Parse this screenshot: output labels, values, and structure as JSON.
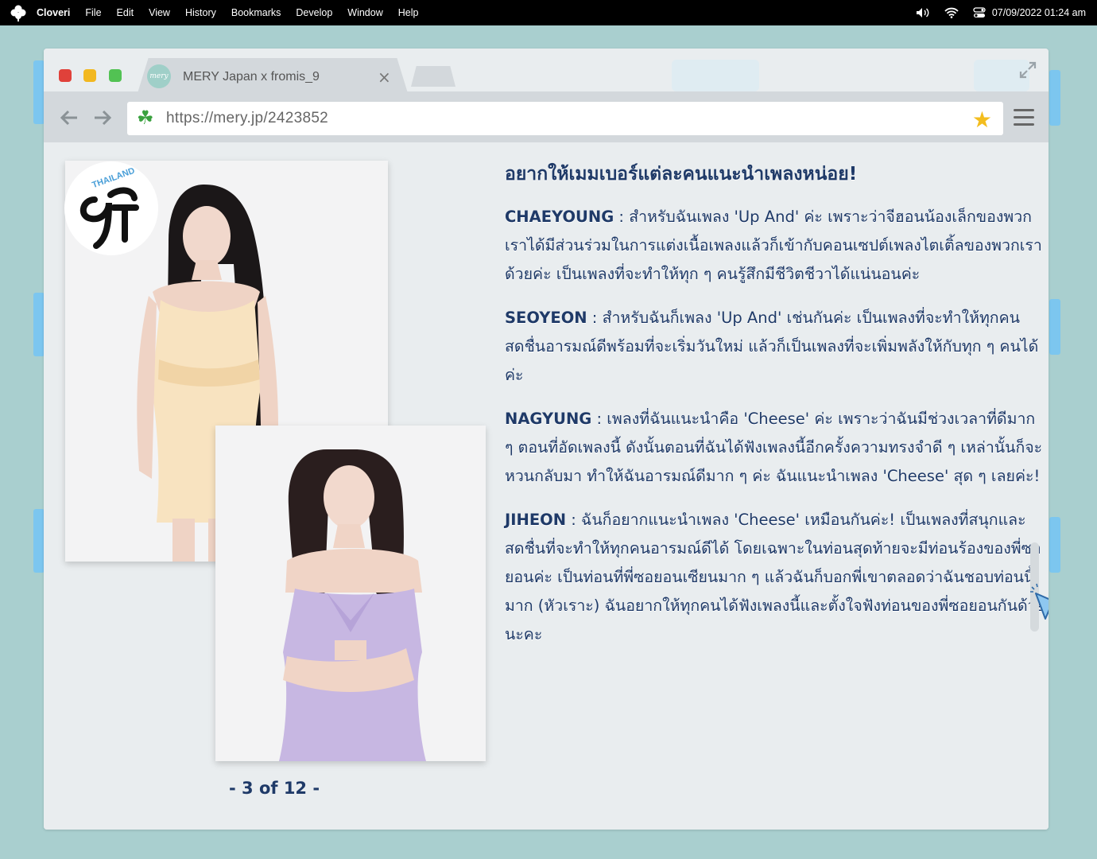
{
  "menubar": {
    "app_name": "Cloveri",
    "items": [
      "File",
      "Edit",
      "View",
      "History",
      "Bookmarks",
      "Develop",
      "Window",
      "Help"
    ],
    "datetime": "07/09/2022  01:24 am",
    "icons": [
      "clover-logo-icon",
      "volume-icon",
      "wifi-icon",
      "toggle-icon"
    ]
  },
  "browser": {
    "tab": {
      "favicon_text": "mery",
      "title": "MERY Japan x fromis_9",
      "close": "×"
    },
    "url": "https://mery.jp/2423852",
    "colors": {
      "red": "#e0413a",
      "yellow": "#f2b820",
      "green": "#52c253",
      "accent": "#1f3a68"
    }
  },
  "article": {
    "heading": "อยากให้เมมเบอร์แต่ละคนแนะนำเพลงหน่อย!",
    "paragraphs": [
      {
        "name": "CHAEYOUNG",
        "sep": " : ",
        "text": "สำหรับฉันเพลง 'Up And' ค่ะ เพราะว่าจีฮอนน้องเล็กของพวกเราได้มีส่วนร่วมในการแต่งเนื้อเพลงแล้วก็เข้ากับคอนเซปต์เพลงไตเติ้ลของพวกเราด้วยค่ะ เป็นเพลงที่จะทำให้ทุก ๆ คนรู้สึกมีชีวิตชีวาได้แน่นอนค่ะ"
      },
      {
        "name": "SEOYEON",
        "sep": " : ",
        "text": "สำหรับฉันก็เพลง 'Up And' เช่นกันค่ะ เป็นเพลงที่จะทำให้ทุกคนสดชื่นอารมณ์ดีพร้อมที่จะเริ่มวันใหม่ แล้วก็เป็นเพลงที่จะเพิ่มพลังให้กับทุก ๆ คนได้ค่ะ"
      },
      {
        "name": "NAGYUNG",
        "sep": " : ",
        "text": "เพลงที่ฉันแนะนำคือ 'Cheese' ค่ะ เพราะว่าฉันมีช่วงเวลาที่ดีมาก ๆ ตอนที่อัดเพลงนี้ ดังนั้นตอนที่ฉันได้ฟังเพลงนี้อีกครั้งความทรงจำดี ๆ เหล่านั้นก็จะหวนกลับมา ทำให้ฉันอารมณ์ดีมาก ๆ ค่ะ ฉันแนะนำเพลง 'Cheese' สุด ๆ เลยค่ะ!"
      },
      {
        "name": "JIHEON",
        "sep": " : ",
        "text": "ฉันก็อยากแนะนำเพลง 'Cheese' เหมือนกันค่ะ! เป็นเพลงที่สนุกและสดชื่นที่จะทำให้ทุกคนอารมณ์ดีได้ โดยเฉพาะในท่อนสุดท้ายจะมีท่อนร้องของพี่ซอยอนค่ะ เป็นท่อนที่พี่ซอยอนเซียนมาก ๆ แล้วฉันก็บอกพี่เขาตลอดว่าฉันชอบท่อนนี้มาก (หัวเราะ) ฉันอยากให้ทุกคนได้ฟังเพลงนี้และตั้งใจฟังท่อนของพี่ซอยอนกันด้วยนะคะ"
      }
    ]
  },
  "gallery": {
    "page_indicator": "- 3 of 12 -",
    "badge_text": "THAILAND"
  }
}
